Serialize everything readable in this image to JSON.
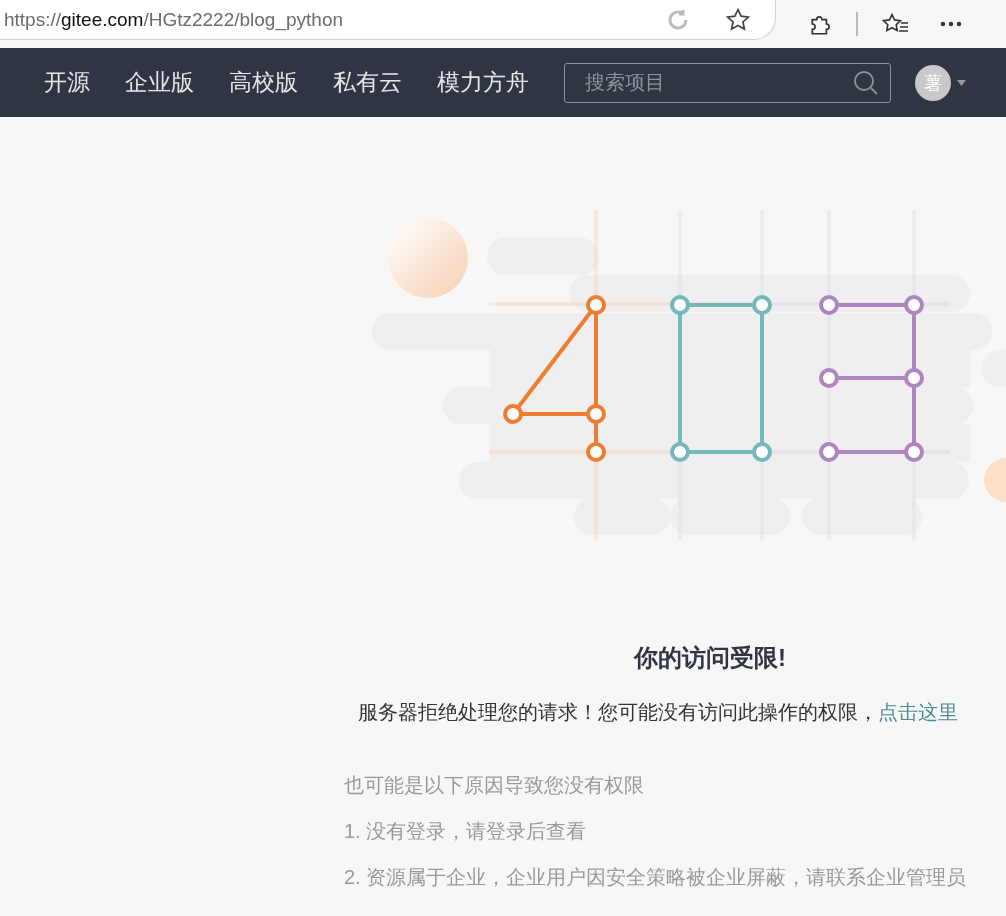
{
  "browser": {
    "url": {
      "scheme": "https://",
      "host": "gitee.com",
      "path": "/HGtz2222/blog_python"
    }
  },
  "nav": {
    "items": [
      {
        "label": "开源"
      },
      {
        "label": "企业版"
      },
      {
        "label": "高校版"
      },
      {
        "label": "私有云"
      },
      {
        "label": "模力方舟"
      }
    ],
    "search": {
      "placeholder": "搜索项目"
    },
    "avatar": {
      "initial": "薯"
    }
  },
  "error": {
    "title": "你的访问受限!",
    "message": "服务器拒绝处理您的请求！您可能没有访问此操作的权限，",
    "link": "点击这里",
    "reasons_heading": "也可能是以下原因导致您没有权限",
    "reasons": [
      "1. 没有登录，请登录后查看",
      "2. 资源属于企业，企业用户因安全策略被企业屏蔽，请联系企业管理员"
    ]
  }
}
